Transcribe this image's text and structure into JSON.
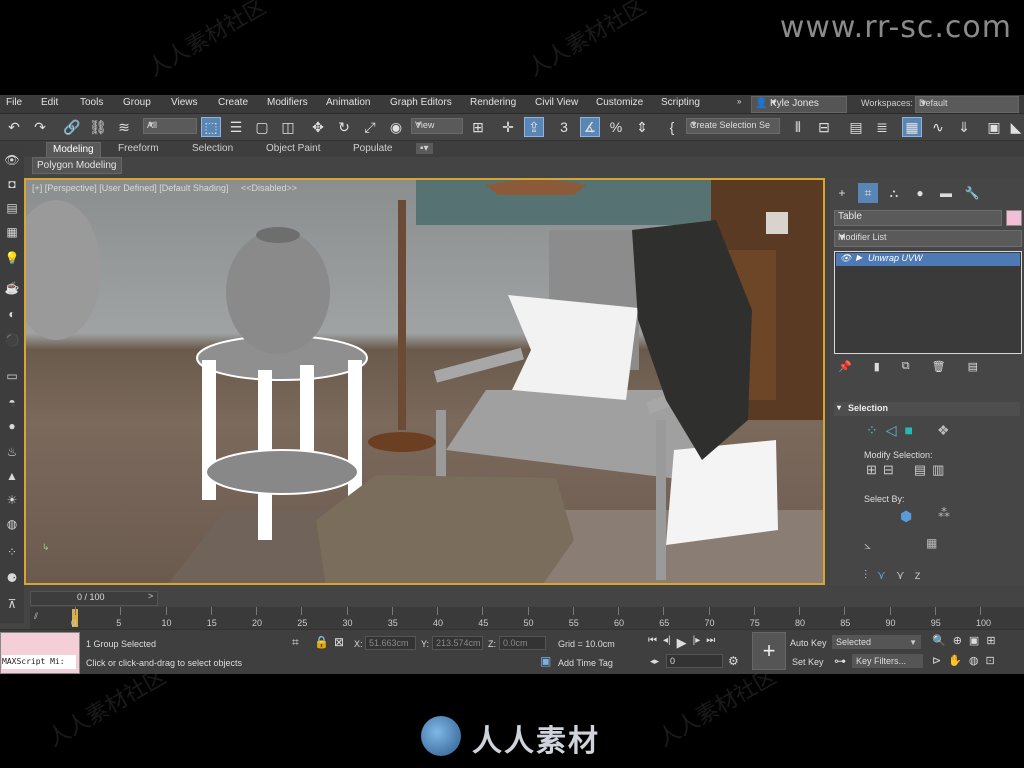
{
  "watermark": {
    "url": "www.rr-sc.com",
    "cn": "人人素材社区",
    "logo_text": "人人素材"
  },
  "menubar": {
    "items": [
      "File",
      "Edit",
      "Tools",
      "Group",
      "Views",
      "Create",
      "Modifiers",
      "Animation",
      "Graph Editors",
      "Rendering",
      "Civil View",
      "Customize",
      "Scripting"
    ],
    "user": "Kyle Jones",
    "workspaces_label": "Workspaces:",
    "workspaces_value": "Default"
  },
  "toolbar": {
    "filter_value": "All",
    "ref_coord": "View",
    "selection_set_placeholder": "Create Selection Se"
  },
  "ribbon": {
    "tabs": [
      "Modeling",
      "Freeform",
      "Selection",
      "Object Paint",
      "Populate"
    ],
    "active_tab": "Modeling",
    "sub_label": "Polygon Modeling"
  },
  "viewport": {
    "label": "[+] [Perspective] [User Defined] [Default Shading]",
    "disabled": "<<Disabled>>"
  },
  "command_panel": {
    "object_name": "Table",
    "object_color": "#f2bfd6",
    "modifier_list": "Modifier List",
    "stack_item": "Unwrap UVW",
    "selection_title": "Selection",
    "modify_selection": "Modify Selection:",
    "select_by": "Select By:"
  },
  "timeline": {
    "frame": "0 / 100",
    "ticks": [
      "0",
      "5",
      "10",
      "15",
      "20",
      "25",
      "30",
      "35",
      "40",
      "45",
      "50",
      "55",
      "60",
      "65",
      "70",
      "75",
      "80",
      "85",
      "90",
      "95",
      "100"
    ]
  },
  "status": {
    "maxscript": "MAXScript Mi:",
    "selected": "1 Group Selected",
    "prompt": "Click or click-and-drag to select objects",
    "x_label": "X:",
    "x_value": "51.663cm",
    "y_label": "Y:",
    "y_value": "213.574cm",
    "z_label": "Z:",
    "z_value": "0.0cm",
    "grid": "Grid = 10.0cm",
    "add_time_tag": "Add Time Tag",
    "auto_key": "Auto Key",
    "set_key": "Set Key",
    "selected_dropdown": "Selected",
    "key_filters": "Key Filters...",
    "frame_field": "0"
  }
}
